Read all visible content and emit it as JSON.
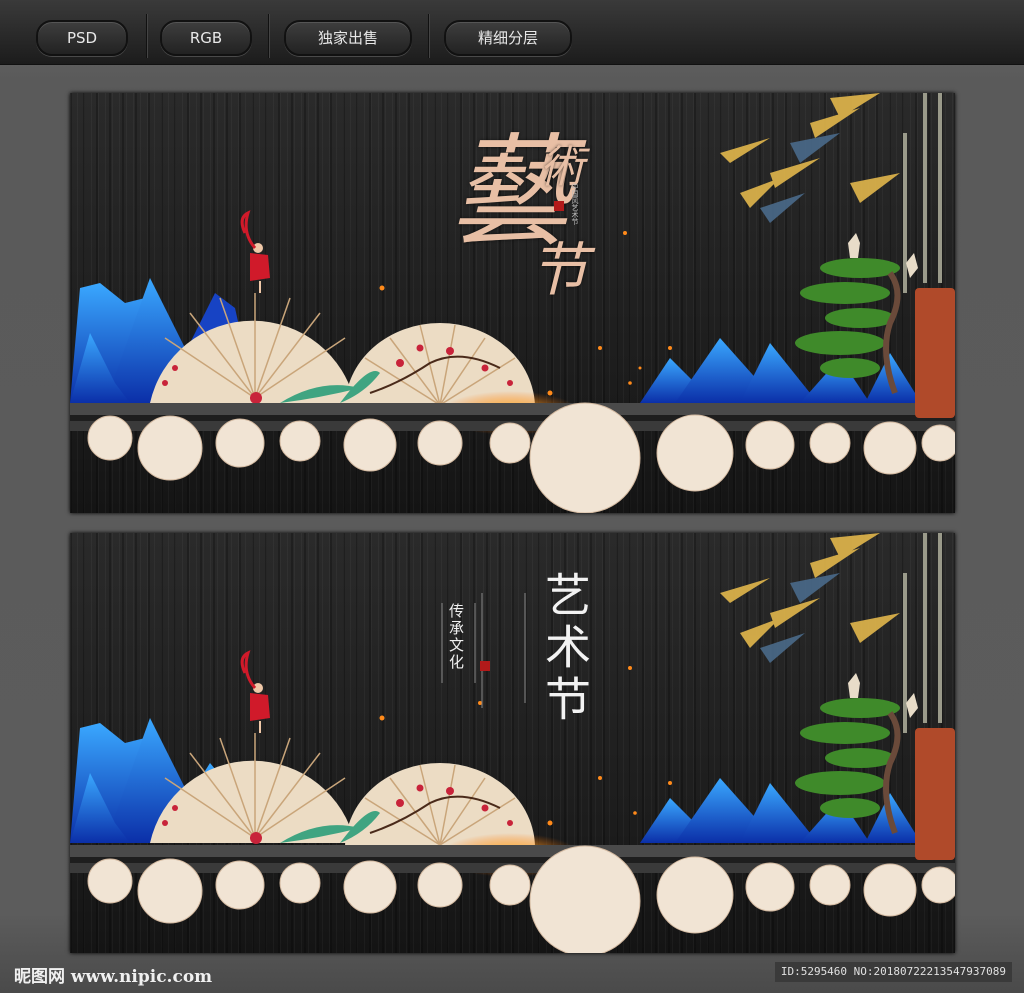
{
  "toolbar": {
    "tags": [
      "PSD",
      "RGB",
      "独家出售",
      "精细分层"
    ]
  },
  "banner1": {
    "calligraphy_main": "藝",
    "calligraphy_sub1": "術",
    "calligraphy_sub2": "节",
    "small_vertical": "中国风艺术节"
  },
  "banner2": {
    "title": "艺术节",
    "subtitle": "传承文化"
  },
  "footer": {
    "logo": "昵图网 www.nipic.com",
    "id_text": "ID:5295460 NO:20180722213547937089"
  },
  "colors": {
    "mountain_blue": "#1f57d6",
    "umbrella": "#ecdcc4",
    "plum_red": "#c8233a",
    "pot": "#b04a2a",
    "pine_green": "#3f8a2a"
  }
}
